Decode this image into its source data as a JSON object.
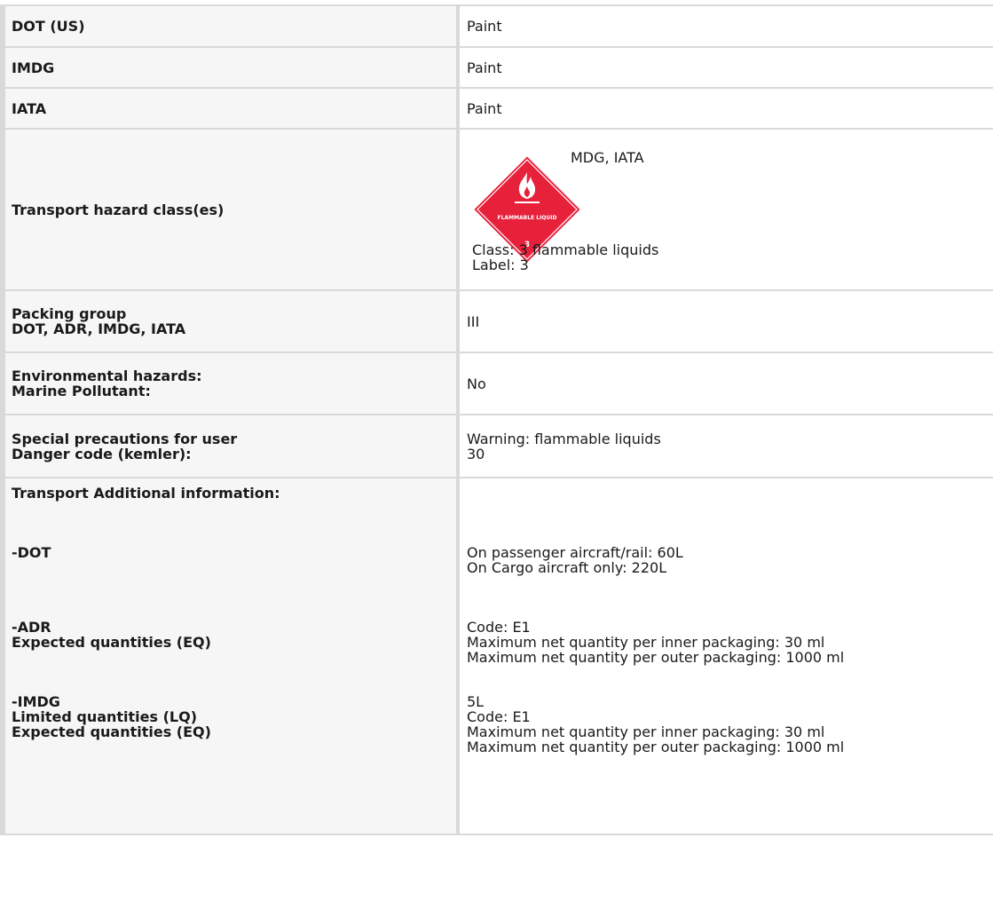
{
  "rows": {
    "dot": {
      "label": "DOT (US)",
      "value": "Paint"
    },
    "imdg": {
      "label": "IMDG",
      "value": "Paint"
    },
    "iata": {
      "label": "IATA",
      "value": "Paint"
    },
    "hazard": {
      "label": "Transport hazard class(es)",
      "header": "MDG, IATA",
      "diamond_text": "FLAMMABLE LIQUID",
      "diamond_number": "3",
      "class_line": "Class: 3 flammable liquids",
      "label_line": "Label: 3",
      "diamond_color": "#e8213b"
    },
    "packing": {
      "label_line1": "Packing group",
      "label_line2": "DOT, ADR, IMDG, IATA",
      "value": "III"
    },
    "env": {
      "label_line1": "Environmental hazards:",
      "label_line2": "Marine Pollutant:",
      "value": "No"
    },
    "special": {
      "label_line1": "Special precautions for user",
      "label_line2": "Danger code (kemler):",
      "value_line1": "Warning: flammable liquids",
      "value_line2": "30"
    },
    "additional": {
      "title": "Transport Additional information:",
      "dot_label": "-DOT",
      "dot_lines": [
        "On passenger aircraft/rail: 60L",
        "On Cargo aircraft only: 220L"
      ],
      "adr_label": "-ADR",
      "adr_sub": "Expected quantities (EQ)",
      "adr_lines": [
        "Code: E1",
        "Maximum net quantity per inner packaging: 30 ml",
        "Maximum net quantity per outer packaging: 1000 ml"
      ],
      "imdg_label": "-IMDG",
      "imdg_sub1": "Limited quantities (LQ)",
      "imdg_sub2": "Expected quantities (EQ)",
      "imdg_lines": [
        "5L",
        "Code: E1",
        "Maximum net quantity per inner packaging: 30 ml",
        "Maximum net quantity per outer packaging: 1000 ml"
      ]
    }
  }
}
